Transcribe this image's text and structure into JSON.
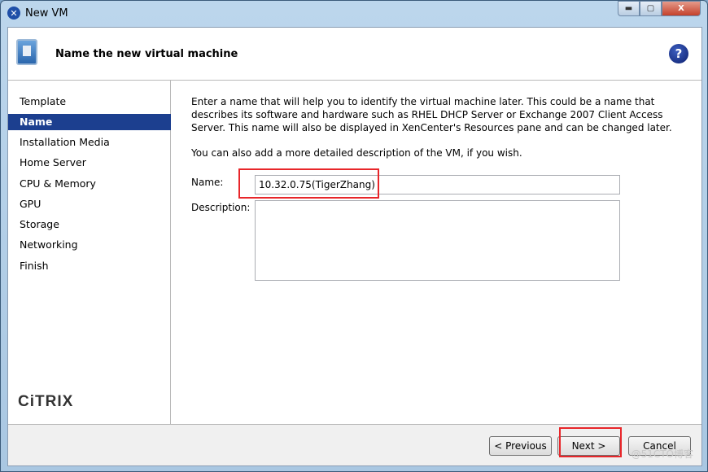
{
  "window": {
    "title": "New VM",
    "app_icon": "xencenter-icon",
    "buttons": {
      "minimize": "minimize-icon",
      "maximize": "maximize-icon",
      "close": "X"
    }
  },
  "header": {
    "title": "Name the new virtual machine",
    "help": "?"
  },
  "sidebar": {
    "items": [
      {
        "label": "Template"
      },
      {
        "label": "Name",
        "active": true
      },
      {
        "label": "Installation Media"
      },
      {
        "label": "Home Server"
      },
      {
        "label": "CPU & Memory"
      },
      {
        "label": "GPU"
      },
      {
        "label": "Storage"
      },
      {
        "label": "Networking"
      },
      {
        "label": "Finish"
      }
    ],
    "logo": "CiTRIX"
  },
  "main": {
    "intro": "Enter a name that will help you to identify the virtual machine later. This could be a name that describes its software and hardware such as RHEL DHCP Server or Exchange 2007 Client Access Server. This name will also be displayed in XenCenter's Resources pane and can be changed later.",
    "desc_hint": "You can also add a more detailed description of the VM, if you wish.",
    "name_label": "Name:",
    "name_value": "10.32.0.75(TigerZhang)",
    "description_label": "Description:",
    "description_value": ""
  },
  "footer": {
    "previous": "< Previous",
    "next": "Next >",
    "cancel": "Cancel"
  },
  "annotation_color": "#e8262a",
  "watermark": "@51CTO博客"
}
